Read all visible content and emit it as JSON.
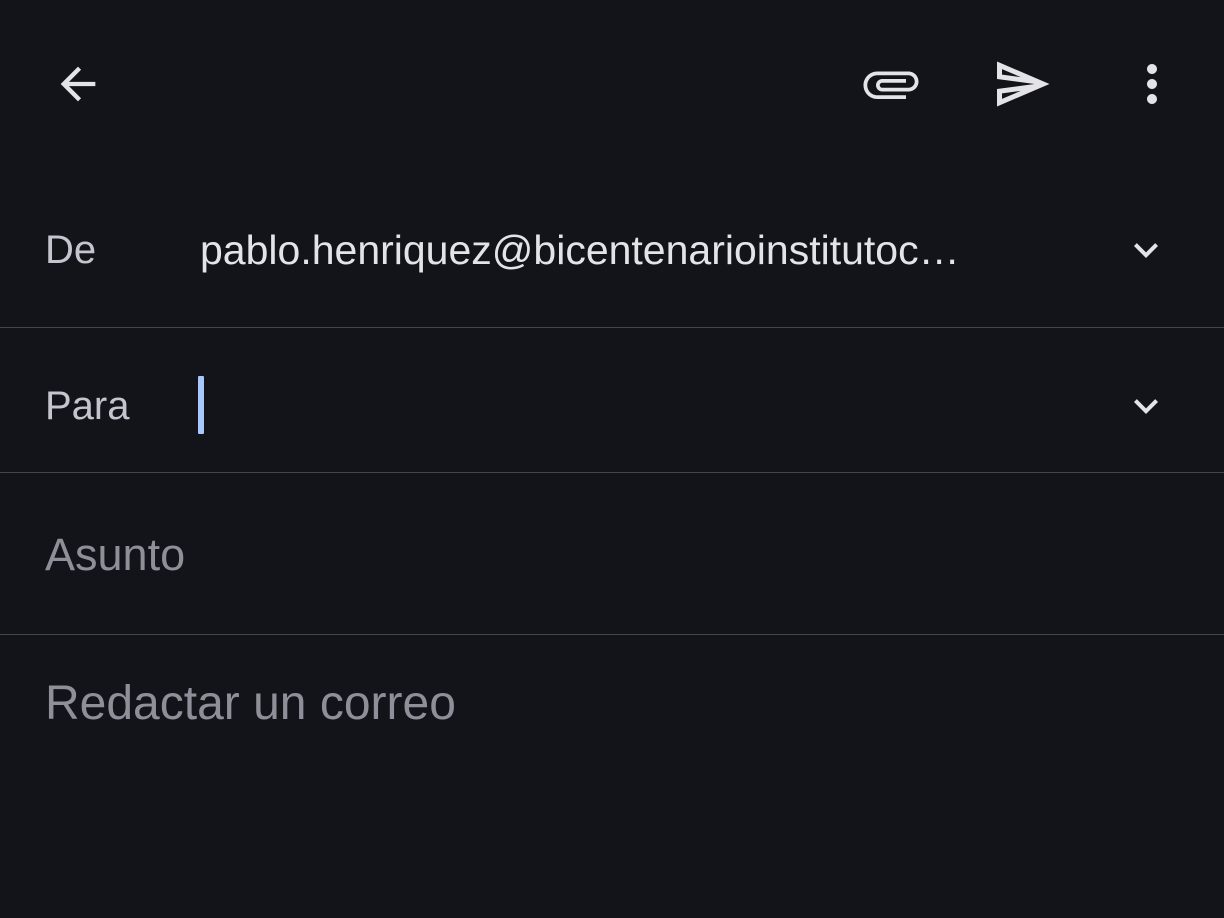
{
  "toolbar": {
    "back_icon": "arrow-back-icon",
    "attach_icon": "paperclip-icon",
    "send_icon": "send-icon",
    "more_icon": "more-vert-icon"
  },
  "compose": {
    "from_label": "De",
    "from_value": "pablo.henriquez@bicentenarioinstitutoc…",
    "to_label": "Para",
    "to_value": "",
    "subject_placeholder": "Asunto",
    "body_placeholder": "Redactar un correo"
  },
  "colors": {
    "background": "#131419",
    "divider": "#45464d",
    "label": "#c4c6cf",
    "text": "#e3e3e8",
    "placeholder": "#8e9099",
    "caret": "#a8c7fa"
  }
}
